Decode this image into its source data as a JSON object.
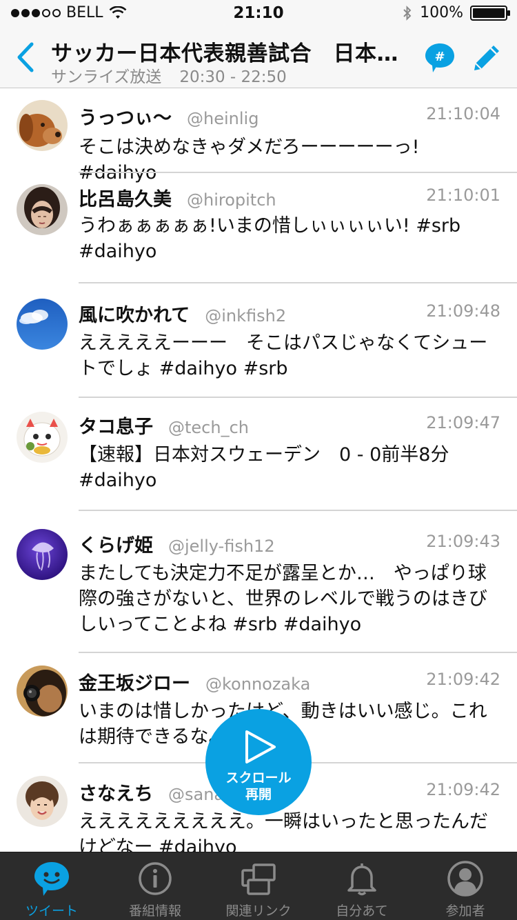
{
  "status_bar": {
    "carrier": "BELL",
    "time": "21:10",
    "battery": "100%"
  },
  "header": {
    "title": "サッカー日本代表親善試合　日本対スウェーデン",
    "channel": "サンライズ放送",
    "airtime": "20:30 - 22:50",
    "hashtag_icon": "#"
  },
  "tweets": [
    {
      "name": "うっつぃ〜",
      "handle": "@heinlig",
      "time": "21:10:04",
      "text": "そこは決めなきゃダメだろーーーーーっ! #daihyo"
    },
    {
      "name": "比呂島久美",
      "handle": "@hiropitch",
      "time": "21:10:01",
      "text": "うわぁぁぁぁぁ!いまの惜しぃぃぃぃい! #srb #daihyo"
    },
    {
      "name": "風に吹かれて",
      "handle": "@inkfish2",
      "time": "21:09:48",
      "text": "えええええーーー　そこはパスじゃなくてシュートでしょ #daihyo #srb"
    },
    {
      "name": "タコ息子",
      "handle": "@tech_ch",
      "time": "21:09:47",
      "text": "【速報】日本対スウェーデン　0 - 0前半8分 #daihyo"
    },
    {
      "name": "くらげ姫",
      "handle": "@jelly-fish12",
      "time": "21:09:43",
      "text": "またしても決定力不足が露呈とか…　やっぱり球際の強さがないと、世界のレベルで戦うのはきびしいってことよね #srb #daihyo"
    },
    {
      "name": "金王坂ジロー",
      "handle": "@konnozaka",
      "time": "21:09:42",
      "text": "いまのは惜しかったけど、動きはいい感じ。これは期待できるな。#daihyo"
    },
    {
      "name": "さなえち",
      "handle": "@sanae",
      "time": "21:09:42",
      "text": "えええええええええ。一瞬はいったと思ったんだけどなー #daihyo"
    }
  ],
  "scroll_button": {
    "line1": "スクロール",
    "line2": "再開"
  },
  "tabs": [
    {
      "label": "ツイート",
      "icon": "tweet-bubble-icon",
      "active": true
    },
    {
      "label": "番組情報",
      "icon": "info-icon",
      "active": false
    },
    {
      "label": "関連リンク",
      "icon": "related-links-icon",
      "active": false
    },
    {
      "label": "自分あて",
      "icon": "bell-icon",
      "active": false
    },
    {
      "label": "参加者",
      "icon": "participants-icon",
      "active": false
    }
  ],
  "colors": {
    "accent": "#0aa1e2",
    "tab_bar": "#2c2c2c",
    "muted_text": "#9a9a9a"
  }
}
